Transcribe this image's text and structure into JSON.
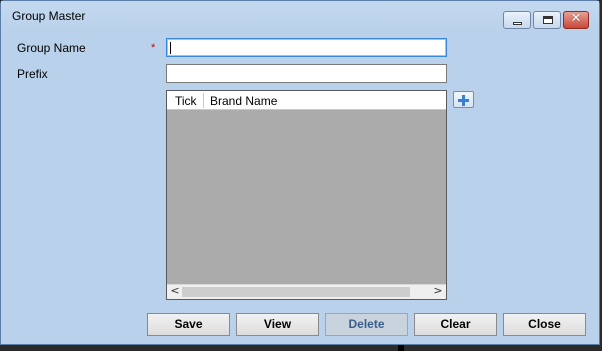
{
  "window": {
    "title": "Group Master",
    "controls": {
      "minimize": "minimize-icon",
      "maximize": "maximize-icon",
      "close": "close-icon",
      "close_glyph": "✕"
    }
  },
  "form": {
    "group_name": {
      "label": "Group Name",
      "required_marker": "*",
      "value": ""
    },
    "prefix": {
      "label": "Prefix",
      "value": ""
    }
  },
  "grid": {
    "columns": [
      "Tick",
      "Brand Name"
    ],
    "rows": [],
    "scroll_left": "<",
    "scroll_right": ">"
  },
  "add_button": {
    "icon": "plus-icon"
  },
  "buttons": {
    "save": "Save",
    "view": "View",
    "delete": "Delete",
    "clear": "Clear",
    "close": "Close"
  },
  "colors": {
    "window_bg": "#b9d1ea",
    "grid_bg": "#ababab",
    "required": "#d00000"
  }
}
